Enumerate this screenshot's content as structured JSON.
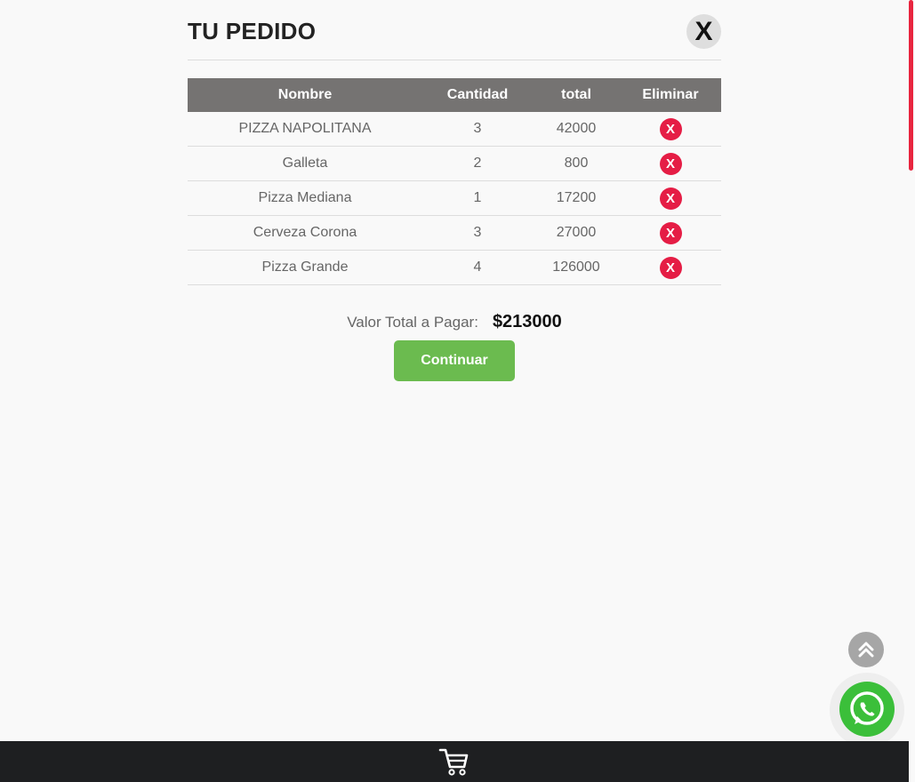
{
  "header": {
    "title": "TU PEDIDO",
    "close_label": "X"
  },
  "table": {
    "columns": [
      "Nombre",
      "Cantidad",
      "total",
      "Eliminar"
    ],
    "rows": [
      {
        "nombre": "PIZZA NAPOLITANA",
        "cantidad": "3",
        "total": "42000",
        "delete_label": "X"
      },
      {
        "nombre": "Galleta",
        "cantidad": "2",
        "total": "800",
        "delete_label": "X"
      },
      {
        "nombre": "Pizza Mediana",
        "cantidad": "1",
        "total": "17200",
        "delete_label": "X"
      },
      {
        "nombre": "Cerveza Corona",
        "cantidad": "3",
        "total": "27000",
        "delete_label": "X"
      },
      {
        "nombre": "Pizza Grande",
        "cantidad": "4",
        "total": "126000",
        "delete_label": "X"
      }
    ]
  },
  "summary": {
    "label": "Valor Total a Pagar:",
    "value": "$213000"
  },
  "actions": {
    "continue_label": "Continuar"
  },
  "floating": {
    "scroll_top_icon": "double-chevron-up-icon",
    "whatsapp_icon": "whatsapp-icon"
  },
  "bottom_bar": {
    "cart_icon": "shopping-cart-icon"
  },
  "colors": {
    "background": "#f9f9f9",
    "table_header": "#757372",
    "delete_red": "#e51d45",
    "continue_green": "#6bbb4f",
    "whatsapp_green": "#3bbf3a",
    "bottom_bar": "#1e1f21",
    "scrollbar_accent": "#e8253f"
  }
}
